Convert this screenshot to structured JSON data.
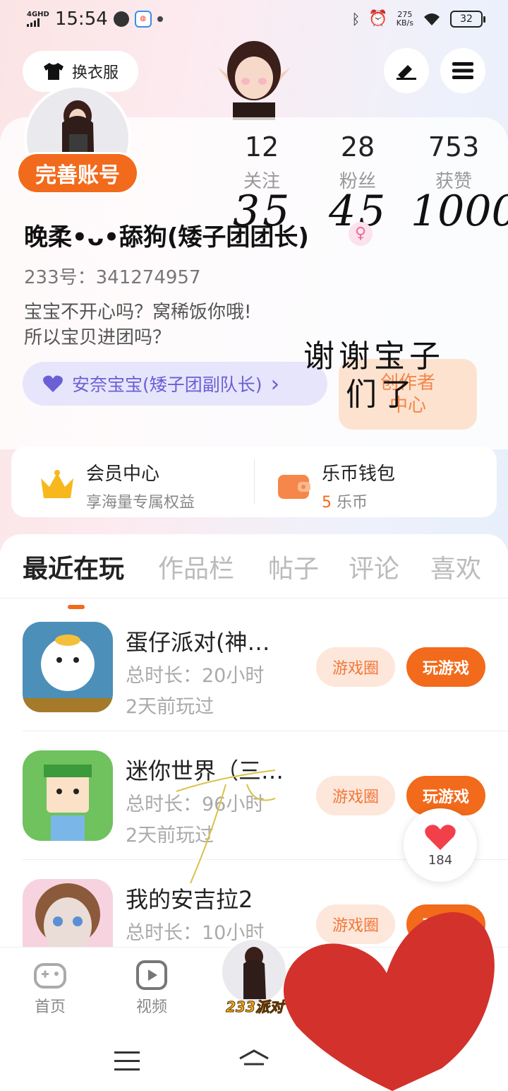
{
  "status_bar": {
    "network": "4GHD",
    "time": "15:54",
    "speed_value": "275",
    "speed_unit": "KB/s",
    "battery": "32"
  },
  "header": {
    "dress_label": "换衣服",
    "edit_icon": "pen-icon",
    "menu_icon": "hamburger-icon"
  },
  "profile": {
    "complete_label": "完善账号",
    "stats": [
      {
        "value": "12",
        "label": "关注",
        "handwritten": "35"
      },
      {
        "value": "28",
        "label": "粉丝",
        "handwritten": "45"
      },
      {
        "value": "753",
        "label": "获赞",
        "handwritten": "1000"
      }
    ],
    "nickname": "晚柔•ᴗ•舔狗(矮子团团长)",
    "gender_symbol": "♀",
    "uid": "233号：341274957",
    "bio_line1": "宝宝不开心吗？窝稀饭你哦!",
    "bio_line2": "所以宝贝进团吗？",
    "group_label": "安奈宝宝(矮子团副队长)",
    "group_chevron": "›",
    "creator_line1": "创作者",
    "creator_line2": "中心",
    "hand_note_line1": "谢谢宝子",
    "hand_note_line2": "们了"
  },
  "membership": {
    "vip_title": "会员中心",
    "vip_sub": "享海量专属权益",
    "wallet_title": "乐币钱包",
    "wallet_amount": "5",
    "wallet_unit": "乐币"
  },
  "tabs": [
    "最近在玩",
    "作品栏",
    "帖子",
    "评论",
    "喜欢"
  ],
  "games": [
    {
      "name": "蛋仔派对(神…",
      "total": "总时长：20小时",
      "last": "2天前玩过",
      "circle": "游戏圈",
      "play": "玩游戏"
    },
    {
      "name": "迷你世界（三…",
      "total": "总时长：96小时",
      "last": "2天前玩过",
      "circle": "游戏圈",
      "play": "玩游戏"
    },
    {
      "name": "我的安吉拉2",
      "total": "总时长：10小时",
      "last": "",
      "circle": "游戏圈",
      "play": "玩游戏"
    }
  ],
  "like_float": {
    "count": "184"
  },
  "bottom_nav": {
    "home": "首页",
    "video": "视频",
    "center": "233派对"
  },
  "colors": {
    "accent": "#f26a1b",
    "purple": "#6b5fd6",
    "heart": "#d2322b"
  }
}
